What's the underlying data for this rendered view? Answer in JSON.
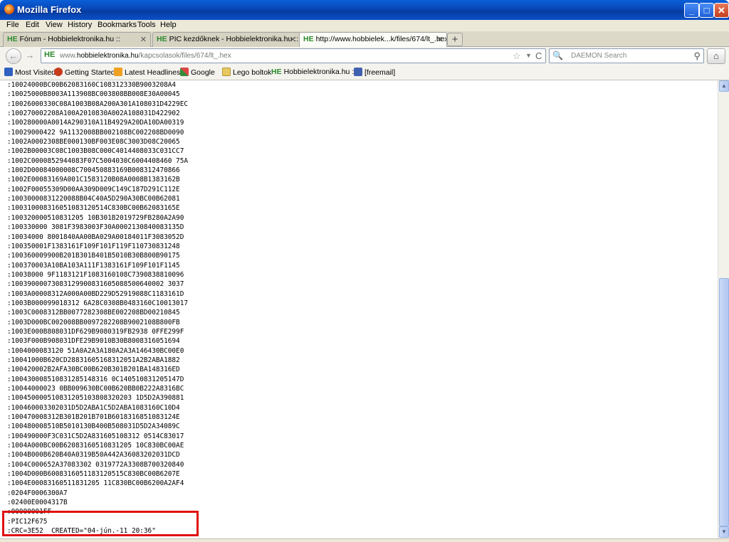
{
  "window": {
    "title": "Mozilla Firefox",
    "min_glyph": "_",
    "max_glyph": "□",
    "close_glyph": "✕"
  },
  "menu": [
    "File",
    "Edit",
    "View",
    "History",
    "Bookmarks",
    "Tools",
    "Help"
  ],
  "tabs": [
    {
      "favicon": "HE",
      "label": "Fórum - Hobbielektronika.hu ::",
      "close": "✕",
      "active": false
    },
    {
      "favicon": "HE",
      "label": "PIC kezdőknek - Hobbielektronika.hu ::",
      "close": "✕",
      "active": false
    },
    {
      "favicon": "HE",
      "label": "http://www.hobbielek...k/files/674/lt_.hex",
      "close": "✕",
      "active": true
    }
  ],
  "new_tab": "+",
  "nav": {
    "back": "←",
    "forward": "→",
    "site_badge": "HE",
    "url_prefix": "www.",
    "url_domain": "hobbielektronika.hu",
    "url_path": "/kapcsolasok/files/674/lt_.hex",
    "star": "☆",
    "dropdown": "▼",
    "reload": "C",
    "search_engine_icon": "🔍",
    "search_placeholder": "DAEMON Search",
    "search_go": "⚲",
    "home": "⌂"
  },
  "bookmarks": [
    {
      "label": "Most Visited",
      "icon": "most-visited-icon",
      "color": "#3060c0"
    },
    {
      "label": "Getting Started",
      "icon": "firefox-icon",
      "color": "#c83c1c"
    },
    {
      "label": "Latest Headlines",
      "icon": "rss-icon",
      "color": "#f0a020"
    },
    {
      "label": "Google",
      "icon": "google-icon",
      "color": "#3a8a3a"
    },
    {
      "label": "Lego boltok",
      "icon": "folder-icon",
      "color": "#e8c860"
    },
    {
      "label": "Hobbielektronika.hu ::",
      "icon": "he-icon",
      "color": "#2a8a2a"
    },
    {
      "label": "[freemail]",
      "icon": "freemail-icon",
      "color": "#4060b0"
    }
  ],
  "hex_lines": [
    ":10024000BC00B62083160C108312330B9003208A4",
    ":10025000B8003A113908BC003808BB008E30A00045",
    ":10026000330C08A1003B08A200A301A108031D4229EC",
    ":100270002208A100A2010830A002A108031D422902",
    ":100280000A0014A290310A11B4929A20DA10DA00319",
    ":10029000422 9A1132008BB002108BC002208BD0090",
    ":1002A0002308BE000130BF003E08C3003D08C20065",
    ":1002B00003C08C1003B08C000C4014408033C031CC7",
    ":1002C0000852944083F07C5004030C6004408460 75A",
    ":1002D00084000008C700450883169B008312470866",
    ":1002E00083169A001C1583120B08A0008B1383162B",
    ":1002F00055309D00AA309D009C149C187D291C112E",
    ":10030000831220088B04C40A5D290A30BC00B62081",
    ":100310008316051083120514C830BC00B62083165E",
    ":100320000510831205 10B301B2019729FB280A2A90",
    ":100330000 3081F3983003F30A0002130840083135D",
    ":10034000 8001840AA00BA029A00184011F3083052D",
    ":100350001F1383161F109F101F119F110730831248",
    ":100360009900B201B301B401B5010B30B800B90175",
    ":100370003A10BA103A111F1383161F109F101F1145",
    ":10038000 9F1183121F1083160108C7390838810096",
    ":10039000073083129900831605088500640002 3037",
    ":1003A00008312A000A00BD229D52919088C1183161D",
    ":1003B000099018312 6A28C0308B0483160C10013017",
    ":1003C0008312BB0077282308BE002208BD00210845",
    ":1003D000BC002008BB0097282208B9002108B800FB",
    ":1003E000B808031DF629B9080319FB2938 0FFE299F",
    ":1003F000B908031DFE29B9010B30B8008316051694",
    ":1004000083120 51A0A2A3A180A2A3A146430BC00E0",
    ":10041000B620CD28831605168312051A2B2ABA1882",
    ":100420002B2AFA30BC00B620B301B201BA148316ED",
    ":100430008510831285148316 0C140510831205147D",
    ":10044000023 0BB009630BC00B620BB0B222A8316BC",
    ":100450000510831205103808320203 1D5D2A390881",
    ":100460003302031D5D2ABA1C5D2ABA1083160C10D4",
    ":100470008312B301B201B701B6018316851083124E",
    ":100480008510B5010130B400B508031D5D2A34089C",
    ":100490000F3C031C5D2A831605108312 0514C83017",
    ":1004A000BC00B62083160510831205 10C830BC00AE",
    ":1004B000B620B40A0319B50A442A36083202031DCD",
    ":1004C000652A37083302 0319772A3308B700320840",
    ":1004D000B6008316051183120515C830BC00B6207E",
    ":1004E00083160511831205 11C830BC00B6200A2AF4",
    ":0204F0006300A7",
    ":02400E0004317B",
    ":00000001FF",
    ":PIC12F675",
    ":CRC=3E52  CREATED=\"04-jún.-11 20:36\""
  ],
  "scroll": {
    "up": "▲",
    "down": "▼",
    "position_fraction": 0.45
  }
}
